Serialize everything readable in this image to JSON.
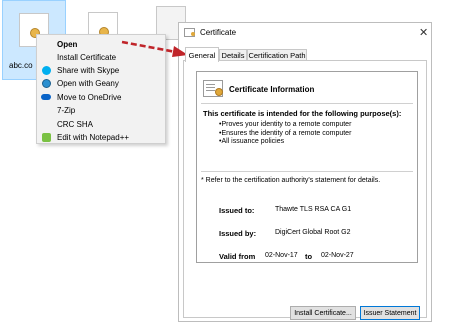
{
  "desktop": {
    "selected_file_label": "abc.co"
  },
  "context_menu": {
    "items": [
      {
        "label": "Open",
        "icon": "none",
        "bold": true
      },
      {
        "label": "Install Certificate",
        "icon": "none",
        "bold": false
      },
      {
        "label": "Share with Skype",
        "icon": "skype-icon",
        "bold": false
      },
      {
        "label": "Open with Geany",
        "icon": "geany-icon",
        "bold": false
      },
      {
        "label": "Move to OneDrive",
        "icon": "onedrive-cloud-icon",
        "bold": false
      },
      {
        "label": "7-Zip",
        "icon": "none",
        "bold": false
      },
      {
        "label": "CRC SHA",
        "icon": "none",
        "bold": false
      },
      {
        "label": "Edit with Notepad++",
        "icon": "notepad-plus-plus-icon",
        "bold": false
      }
    ]
  },
  "arrow_color": "#c0252a",
  "cert_window": {
    "title": "Certificate",
    "close_glyph": "✕",
    "tabs": [
      {
        "label": "General",
        "active": true
      },
      {
        "label": "Details",
        "active": false
      },
      {
        "label": "Certification Path",
        "active": false
      }
    ],
    "info": {
      "heading": "Certificate Information",
      "purpose_heading": "This certificate is intended for the following purpose(s):",
      "purposes": [
        "Proves your identity to a remote computer",
        "Ensures the identity of a remote computer",
        "All issuance policies"
      ],
      "refer_note": "* Refer to the certification authority's statement for details.",
      "issued_to_label": "Issued to:",
      "issued_to_value": "Thawte TLS RSA CA G1",
      "issued_by_label": "Issued by:",
      "issued_by_value": "DigiCert Global Root G2",
      "valid_from_label": "Valid from",
      "valid_from_value": "02-Nov-17",
      "valid_to_label": "to",
      "valid_to_value": "02-Nov-27"
    },
    "buttons": {
      "install_label": "Install Certificate...",
      "issuer_label": "Issuer Statement"
    }
  }
}
